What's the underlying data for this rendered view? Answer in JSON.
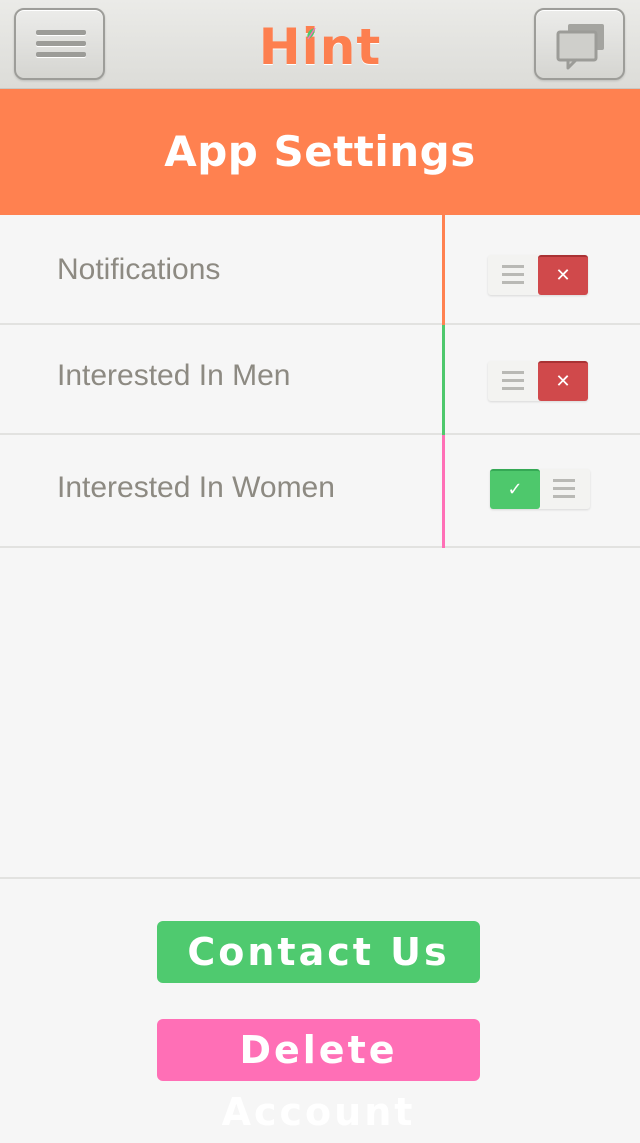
{
  "app": {
    "logo_text": "Hint"
  },
  "colors": {
    "accent_orange": "#ff8150",
    "green": "#4ec86c",
    "pink": "#ff6fb6",
    "red": "#d0494b"
  },
  "header": {
    "title": "App Settings"
  },
  "settings": [
    {
      "label": "Notifications",
      "enabled": false,
      "icon": "x-icon"
    },
    {
      "label": "Interested In Men",
      "enabled": false,
      "icon": "x-icon"
    },
    {
      "label": "Interested In Women",
      "enabled": true,
      "icon": "check-icon"
    }
  ],
  "toggle_marks": {
    "off": "✕",
    "on": "✓"
  },
  "actions": {
    "contact_label": "Contact Us",
    "delete_label": "Delete Account"
  }
}
